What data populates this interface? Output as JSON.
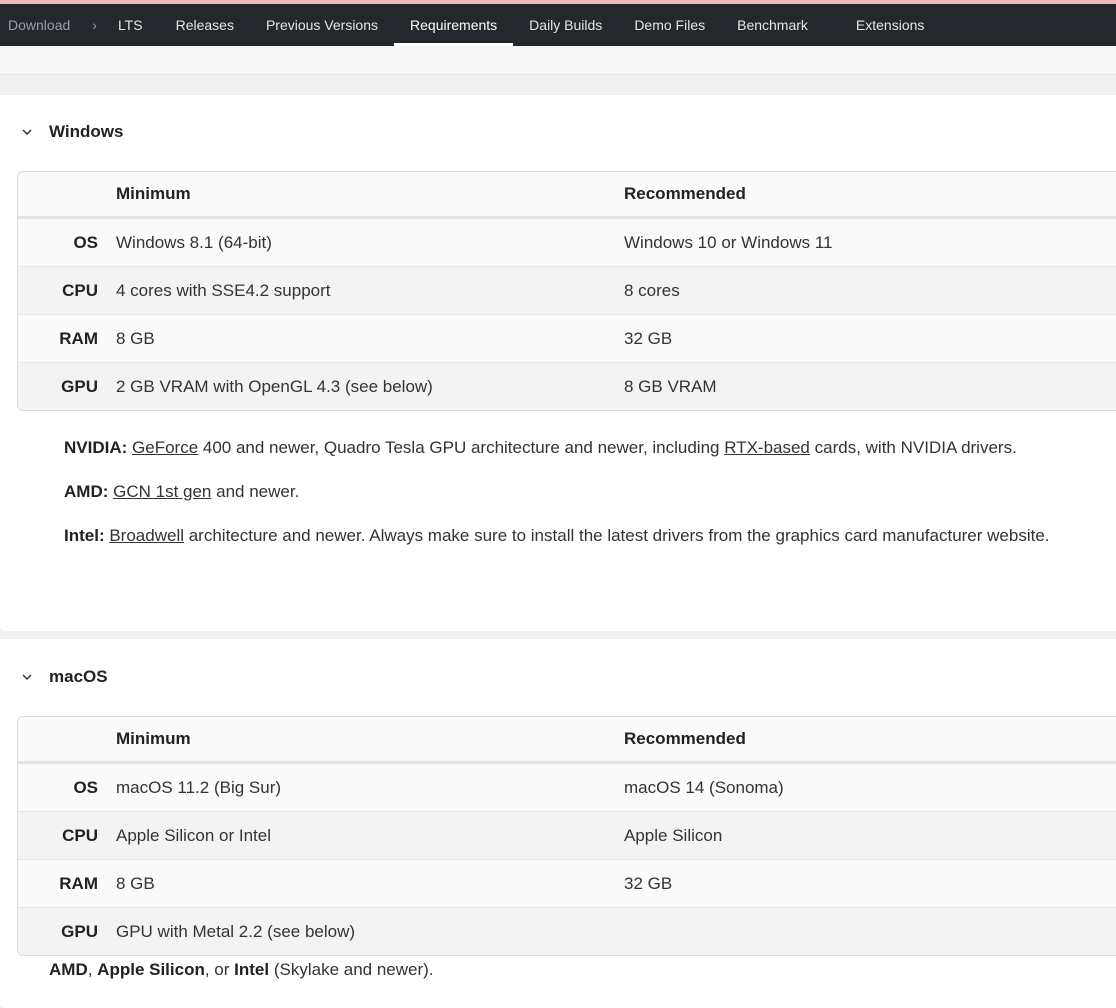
{
  "nav": {
    "items": [
      "Download",
      "LTS",
      "Releases",
      "Previous Versions",
      "Requirements",
      "Daily Builds",
      "Demo Files",
      "Benchmark",
      "Extensions"
    ],
    "separator": "›",
    "active": "Requirements"
  },
  "windows": {
    "title": "Windows",
    "headers": {
      "minimum": "Minimum",
      "recommended": "Recommended"
    },
    "rows": [
      {
        "label": "OS",
        "minimum": "Windows 8.1 (64-bit)",
        "recommended": "Windows 10 or Windows 11"
      },
      {
        "label": "CPU",
        "minimum": "4 cores with SSE4.2 support",
        "recommended": "8 cores"
      },
      {
        "label": "RAM",
        "minimum": "8 GB",
        "recommended": "32 GB"
      },
      {
        "label": "GPU",
        "minimum": "2 GB VRAM with OpenGL 4.3 (see below)",
        "recommended": "8 GB VRAM"
      }
    ],
    "notes": {
      "nvidia_label": "NVIDIA:",
      "nvidia_link1": "GeForce",
      "nvidia_text1": " 400 and newer, Quadro Tesla GPU architecture and newer, including ",
      "nvidia_link2": "RTX-based",
      "nvidia_text2": " cards, with NVIDIA drivers.",
      "amd_label": "AMD:",
      "amd_link": "GCN 1st gen",
      "amd_text": " and newer.",
      "intel_label": "Intel:",
      "intel_link": "Broadwell",
      "intel_text": " architecture and newer. Always make sure to install the latest drivers from the graphics card manufacturer website."
    }
  },
  "macos": {
    "title": "macOS",
    "headers": {
      "minimum": "Minimum",
      "recommended": "Recommended"
    },
    "rows": [
      {
        "label": "OS",
        "minimum": "macOS 11.2 (Big Sur)",
        "recommended": "macOS 14 (Sonoma)"
      },
      {
        "label": "CPU",
        "minimum": "Apple Silicon or Intel",
        "recommended": "Apple Silicon"
      },
      {
        "label": "RAM",
        "minimum": "8 GB",
        "recommended": "32 GB"
      },
      {
        "label": "GPU",
        "minimum": "GPU with Metal 2.2 (see below)",
        "recommended": ""
      }
    ],
    "note": {
      "amd": "AMD",
      "sep1": ", ",
      "apple": "Apple Silicon",
      "sep2": ", or ",
      "intel": "Intel",
      "tail": " (Skylake and newer)."
    }
  },
  "colors": {
    "nav_bg": "#24282d",
    "accent_stripe": "#e9b7bc",
    "page_bg": "#f1f1f1"
  }
}
